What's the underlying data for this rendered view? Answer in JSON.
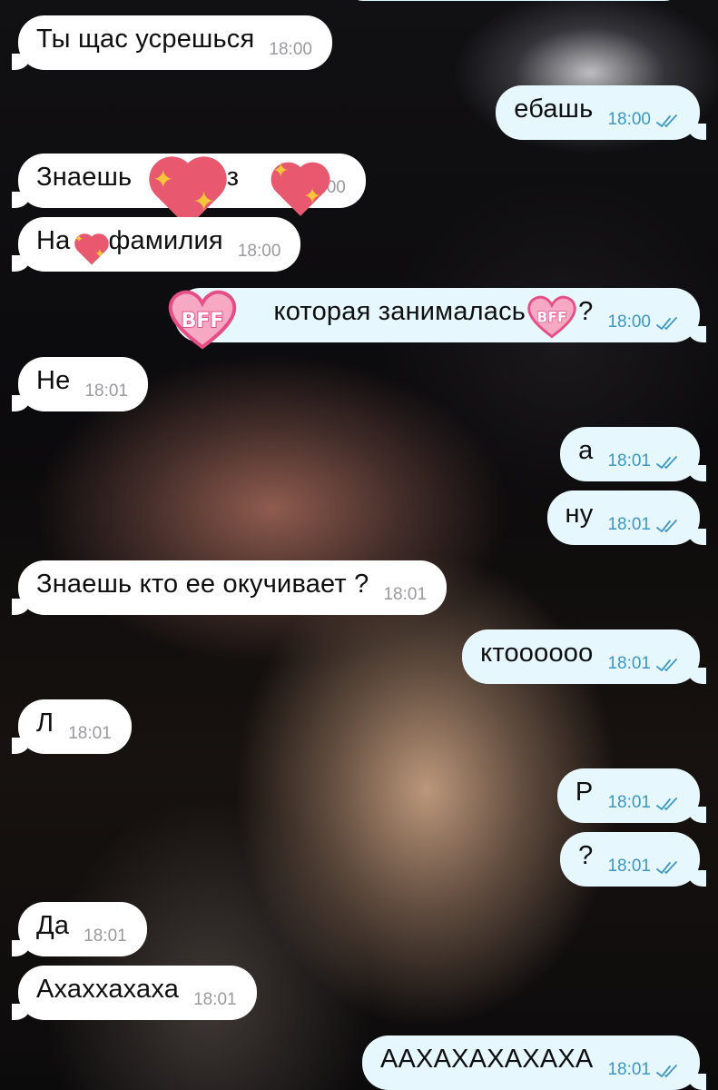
{
  "colors": {
    "incoming_bubble": "#ffffff",
    "outgoing_bubble": "#e6f7fd",
    "incoming_time": "#9a9a9e",
    "outgoing_time_and_ticks": "#3d97c4",
    "heart_sticker": "#e8586f",
    "bff_heart": "#f7a9c4",
    "sparkle": "#f7c43a"
  },
  "messages": [
    {
      "direction": "in",
      "text": "Ты щас усрешься",
      "time": "18:00"
    },
    {
      "direction": "out",
      "text": "ебашь",
      "time": "18:00",
      "status": "read-double-check-icon"
    },
    {
      "direction": "in",
      "text": "Знаешь",
      "text_after": "из",
      "time": "18:00",
      "stickers": [
        "sparkling-heart-icon",
        "sparkling-heart-icon"
      ]
    },
    {
      "direction": "in",
      "text": "На",
      "text_after": "фамилия",
      "time": "18:00",
      "stickers": [
        "sparkling-heart-icon"
      ]
    },
    {
      "direction": "out",
      "text": "которая занималась",
      "text_after": "?",
      "time": "18:00",
      "status": "read-double-check-icon",
      "stickers": [
        "bff-heart-icon",
        "bff-heart-icon"
      ]
    },
    {
      "direction": "in",
      "text": "Не",
      "time": "18:01"
    },
    {
      "direction": "out",
      "text": "а",
      "time": "18:01",
      "status": "read-double-check-icon"
    },
    {
      "direction": "out",
      "text": "ну",
      "time": "18:01",
      "status": "read-double-check-icon"
    },
    {
      "direction": "in",
      "text": "Знаешь кто ее окучивает ?",
      "time": "18:01"
    },
    {
      "direction": "out",
      "text": "ктоооооо",
      "time": "18:01",
      "status": "read-double-check-icon"
    },
    {
      "direction": "in",
      "text": "Л",
      "time": "18:01"
    },
    {
      "direction": "out",
      "text": "Р",
      "time": "18:01",
      "status": "read-double-check-icon"
    },
    {
      "direction": "out",
      "text": "?",
      "time": "18:01",
      "status": "read-double-check-icon"
    },
    {
      "direction": "in",
      "text": "Да",
      "time": "18:01"
    },
    {
      "direction": "in",
      "text": "Ахаххахаха",
      "time": "18:01"
    },
    {
      "direction": "out",
      "text": "ААХАХАХАХАХА",
      "time": "18:01",
      "status": "read-double-check-icon"
    }
  ],
  "sticker_text": {
    "bff": "BFF"
  }
}
